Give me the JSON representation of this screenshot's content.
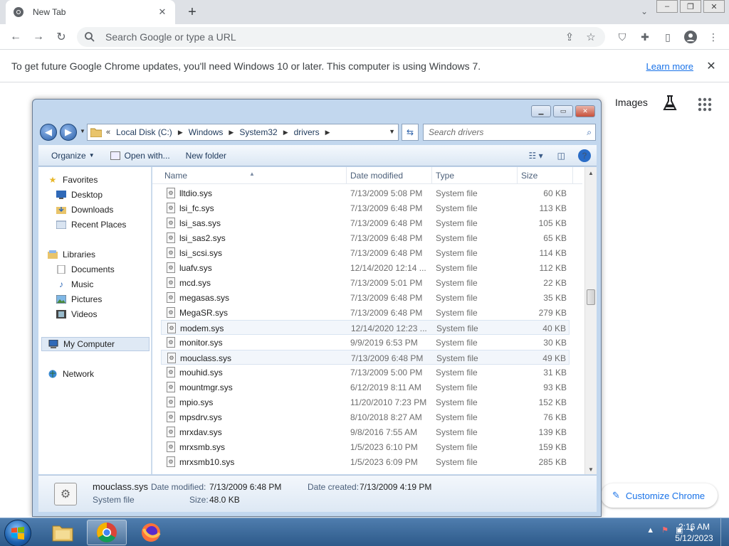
{
  "chrome": {
    "tab_title": "New Tab",
    "omnibox_placeholder": "Search Google or type a URL",
    "infobar_text": "To get future Google Chrome updates, you'll need Windows 10 or later. This computer is using Windows 7.",
    "learn_more": "Learn more",
    "images_link": "Images",
    "customize_label": "Customize Chrome"
  },
  "explorer": {
    "breadcrumb": [
      "Local Disk (C:)",
      "Windows",
      "System32",
      "drivers"
    ],
    "breadcrumb_overflow": "«",
    "search_placeholder": "Search drivers",
    "commands": {
      "organize": "Organize",
      "open_with": "Open with...",
      "new_folder": "New folder"
    },
    "nav": {
      "favorites": "Favorites",
      "desktop": "Desktop",
      "downloads": "Downloads",
      "recent": "Recent Places",
      "libraries": "Libraries",
      "documents": "Documents",
      "music": "Music",
      "pictures": "Pictures",
      "videos": "Videos",
      "computer": "My Computer",
      "network": "Network"
    },
    "columns": {
      "name": "Name",
      "date": "Date modified",
      "type": "Type",
      "size": "Size"
    },
    "files": [
      {
        "name": "lltdio.sys",
        "date": "7/13/2009 5:08 PM",
        "type": "System file",
        "size": "60 KB"
      },
      {
        "name": "lsi_fc.sys",
        "date": "7/13/2009 6:48 PM",
        "type": "System file",
        "size": "113 KB"
      },
      {
        "name": "lsi_sas.sys",
        "date": "7/13/2009 6:48 PM",
        "type": "System file",
        "size": "105 KB"
      },
      {
        "name": "lsi_sas2.sys",
        "date": "7/13/2009 6:48 PM",
        "type": "System file",
        "size": "65 KB"
      },
      {
        "name": "lsi_scsi.sys",
        "date": "7/13/2009 6:48 PM",
        "type": "System file",
        "size": "114 KB"
      },
      {
        "name": "luafv.sys",
        "date": "12/14/2020 12:14 ...",
        "type": "System file",
        "size": "112 KB"
      },
      {
        "name": "mcd.sys",
        "date": "7/13/2009 5:01 PM",
        "type": "System file",
        "size": "22 KB"
      },
      {
        "name": "megasas.sys",
        "date": "7/13/2009 6:48 PM",
        "type": "System file",
        "size": "35 KB"
      },
      {
        "name": "MegaSR.sys",
        "date": "7/13/2009 6:48 PM",
        "type": "System file",
        "size": "279 KB"
      },
      {
        "name": "modem.sys",
        "date": "12/14/2020 12:23 ...",
        "type": "System file",
        "size": "40 KB"
      },
      {
        "name": "monitor.sys",
        "date": "9/9/2019 6:53 PM",
        "type": "System file",
        "size": "30 KB"
      },
      {
        "name": "mouclass.sys",
        "date": "7/13/2009 6:48 PM",
        "type": "System file",
        "size": "49 KB"
      },
      {
        "name": "mouhid.sys",
        "date": "7/13/2009 5:00 PM",
        "type": "System file",
        "size": "31 KB"
      },
      {
        "name": "mountmgr.sys",
        "date": "6/12/2019 8:11 AM",
        "type": "System file",
        "size": "93 KB"
      },
      {
        "name": "mpio.sys",
        "date": "11/20/2010 7:23 PM",
        "type": "System file",
        "size": "152 KB"
      },
      {
        "name": "mpsdrv.sys",
        "date": "8/10/2018 8:27 AM",
        "type": "System file",
        "size": "76 KB"
      },
      {
        "name": "mrxdav.sys",
        "date": "9/8/2016 7:55 AM",
        "type": "System file",
        "size": "139 KB"
      },
      {
        "name": "mrxsmb.sys",
        "date": "1/5/2023 6:10 PM",
        "type": "System file",
        "size": "159 KB"
      },
      {
        "name": "mrxsmb10.sys",
        "date": "1/5/2023 6:09 PM",
        "type": "System file",
        "size": "285 KB"
      }
    ],
    "details": {
      "name": "mouclass.sys",
      "type": "System file",
      "modified_label": "Date modified:",
      "modified_value": "7/13/2009 6:48 PM",
      "created_label": "Date created:",
      "created_value": "7/13/2009 4:19 PM",
      "size_label": "Size:",
      "size_value": "48.0 KB"
    }
  },
  "taskbar": {
    "time": "2:16 AM",
    "date": "5/12/2023"
  }
}
